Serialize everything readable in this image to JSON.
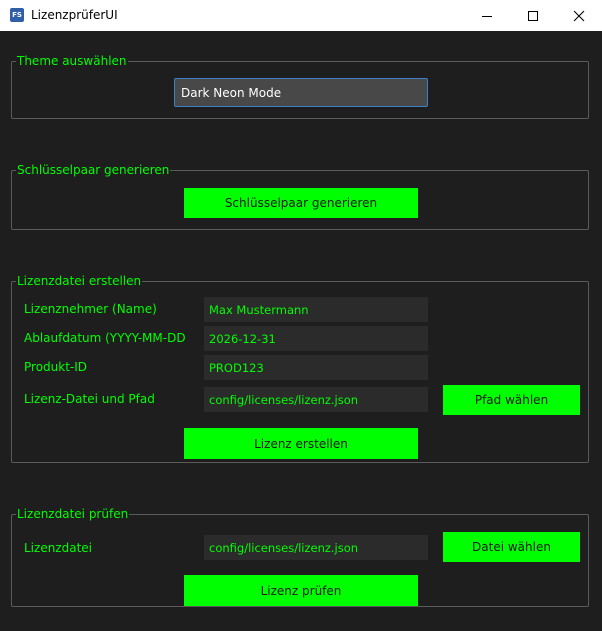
{
  "window": {
    "app_icon_text": "FS",
    "title": "LizenzprüferUI"
  },
  "colors": {
    "accent": "#00ff00",
    "background": "#1e1e1e",
    "field_background": "#2b2b2b"
  },
  "theme_group": {
    "title": "Theme auswählen",
    "selected": "Dark Neon Mode"
  },
  "keypair_group": {
    "title": "Schlüsselpaar generieren",
    "button_label": "Schlüsselpaar generieren"
  },
  "create_group": {
    "title": "Lizenzdatei erstellen",
    "licensee_label": "Lizenznehmer (Name)",
    "licensee_value": "Max Mustermann",
    "expiry_label": "Ablaufdatum (YYYY-MM-DD)",
    "expiry_value": "2026-12-31",
    "product_label": "Produkt-ID",
    "product_value": "PROD123",
    "path_label": "Lizenz-Datei und Pfad",
    "path_value": "config/licenses/lizenz.json",
    "choose_path_label": "Pfad wählen",
    "create_button_label": "Lizenz erstellen"
  },
  "verify_group": {
    "title": "Lizenzdatei prüfen",
    "file_label": "Lizenzdatei",
    "file_value": "config/licenses/lizenz.json",
    "choose_file_label": "Datei wählen",
    "verify_button_label": "Lizenz prüfen"
  }
}
